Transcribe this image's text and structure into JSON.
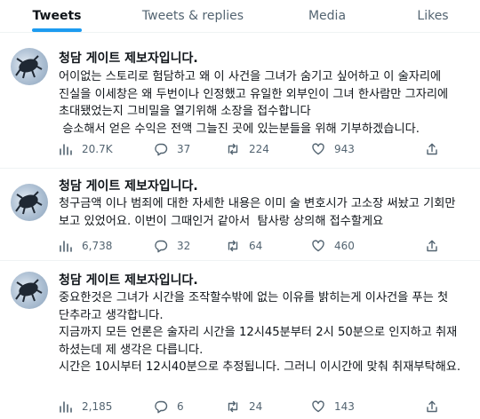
{
  "tabs": [
    "Tweets",
    "Tweets & replies",
    "Media",
    "Likes"
  ],
  "tweets": [
    {
      "author": "청담 게이트 제보자입니다.",
      "text": "어이없는 스토리로 험담하고 왜 이 사건을 그녀가 숨기고 싶어하고 이 술자리에 진실을 이세창은 왜 두번이나 인정했고 유일한 외부인이 그녀 한사람만 그자리에  초대됐었는지 그비밀을 열기위해 소장을 접수합니다\n 승소해서 얻은 수익은 전액 그늘진 곳에 있는분들을 위해 기부하겠습니다.",
      "views": "20.7K",
      "replies": "37",
      "retweets": "224",
      "likes": "943"
    },
    {
      "author": "청담 게이트 제보자입니다.",
      "text": "청구금액 이나 범죄에 대한 자세한 내용은 이미 술 변호시가 고소장 써놨고 기회만 보고 있었어요. 이번이 그때인거 같아서  탐사랑 상의해 접수할게요",
      "views": "6,738",
      "replies": "32",
      "retweets": "64",
      "likes": "460"
    },
    {
      "author": "청담 게이트 제보자입니다.",
      "text": "중요한것은 그녀가 시간을 조작할수밖에 없는 이유를 밝히는게 이사건을 푸는 첫 단추라고 생각합니다.\n지금까지 모든 언론은 술자리 시간을 12시45분부터 2시 50분으로 인지하고 취재 하셨는데 제 생각은 다릅니다.\n시간은 10시부터 12시40분으로 추정됩니다. 그러니 이시간에 맞춰 취재부탁해요.",
      "views": "2,185",
      "replies": "6",
      "retweets": "24",
      "likes": "143"
    }
  ],
  "icons": {
    "views": "bar-chart-icon",
    "reply": "reply-bubble-icon",
    "retweet": "retweet-icon",
    "like": "heart-icon",
    "share": "share-icon"
  },
  "colors": {
    "accent": "#1d9bf0",
    "text": "#0f1419",
    "muted": "#536471",
    "border": "#eff3f4"
  }
}
